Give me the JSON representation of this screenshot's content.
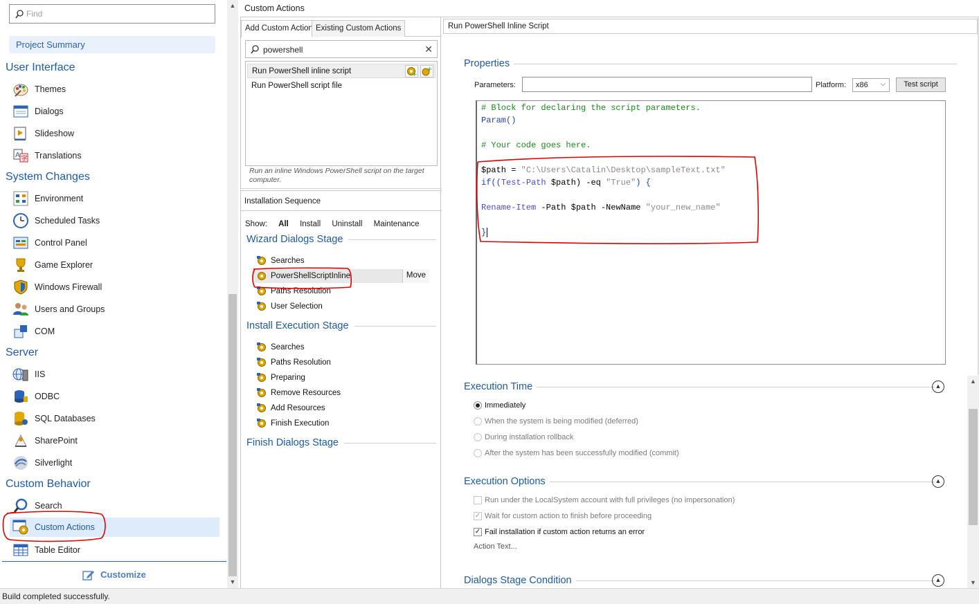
{
  "sidebar": {
    "find_placeholder": "Find",
    "project_summary": "Project Summary",
    "sections": {
      "user_interface": "User Interface",
      "system_changes": "System Changes",
      "server": "Server",
      "custom_behavior": "Custom Behavior"
    },
    "items": {
      "themes": "Themes",
      "dialogs": "Dialogs",
      "slideshow": "Slideshow",
      "translations": "Translations",
      "environment": "Environment",
      "scheduled_tasks": "Scheduled Tasks",
      "control_panel": "Control Panel",
      "game_explorer": "Game Explorer",
      "windows_firewall": "Windows Firewall",
      "users_and_groups": "Users and Groups",
      "com": "COM",
      "iis": "IIS",
      "odbc": "ODBC",
      "sql_databases": "SQL Databases",
      "sharepoint": "SharePoint",
      "silverlight": "Silverlight",
      "search": "Search",
      "custom_actions": "Custom Actions",
      "table_editor": "Table Editor"
    },
    "customize": "Customize"
  },
  "center": {
    "header": "Custom Actions",
    "tabs": [
      "Add Custom Action",
      "Existing Custom Actions"
    ],
    "search_value": "powershell",
    "actions": [
      "Run PowerShell inline script",
      "Run PowerShell script file"
    ],
    "description": "Run an inline Windows PowerShell script on the target computer.",
    "installation_sequence": "Installation Sequence",
    "show_label": "Show:",
    "show_filters": [
      "All",
      "Install",
      "Uninstall",
      "Maintenance"
    ],
    "stages": {
      "wizard": "Wizard Dialogs Stage",
      "install": "Install Execution Stage",
      "finish": "Finish Dialogs Stage"
    },
    "wizard_items": [
      "Searches",
      "PowerShellScriptInline",
      "Paths Resolution",
      "User Selection"
    ],
    "move_label": "Move",
    "install_items": [
      "Searches",
      "Paths Resolution",
      "Preparing",
      "Remove Resources",
      "Add Resources",
      "Finish Execution"
    ]
  },
  "right": {
    "title": "Run PowerShell Inline Script",
    "properties": "Properties",
    "parameters_label": "Parameters:",
    "parameters_value": "",
    "platform_label": "Platform:",
    "platform_value": "x86",
    "test_script": "Test script",
    "code": {
      "l1": "# Block for declaring the script parameters.",
      "l2": "Param()",
      "l3": "# Your code goes here.",
      "l4_var": "$path",
      "l4_eq": " = ",
      "l4_str": "\"C:\\Users\\Catalin\\Desktop\\sampleText.txt\"",
      "l5_if": "if((",
      "l5_cmd": "Test-Path",
      "l5_var": " $path)",
      "l5_op": " -eq ",
      "l5_str": "\"True\"",
      "l5_end": ") {",
      "l6_cmd": "Rename-Item",
      "l6_p1": " -Path ",
      "l6_var": "$path",
      "l6_p2": " -NewName ",
      "l6_str": "\"your_new_name\"",
      "l7": "}"
    },
    "execution_time": "Execution Time",
    "exec_time_options": [
      "Immediately",
      "When the system is being modified (deferred)",
      "During installation rollback",
      "After the system has been successfully modified (commit)"
    ],
    "execution_options": "Execution Options",
    "exec_checks": [
      "Run under the LocalSystem account with full privileges (no impersonation)",
      "Wait for custom action to finish before proceeding",
      "Fail installation if custom action returns an error"
    ],
    "action_text": "Action Text...",
    "dialogs_stage_condition": "Dialogs Stage Condition"
  },
  "status": "Build completed successfully.",
  "colors": {
    "accent": "#1f5aa6",
    "selected_bg": "#ddebfa",
    "annotation": "#e00000"
  }
}
